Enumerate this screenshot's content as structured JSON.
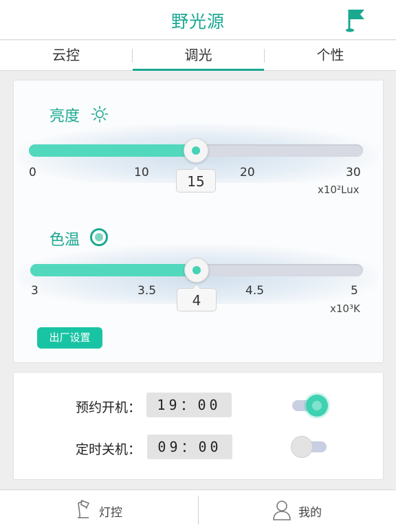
{
  "header": {
    "title": "野光源",
    "flag_icon": "golf-flag-icon"
  },
  "tabs": [
    {
      "label": "云控",
      "active": false
    },
    {
      "label": "调光",
      "active": true
    },
    {
      "label": "个性",
      "active": false
    }
  ],
  "brightness": {
    "title": "亮度",
    "icon": "sun-icon",
    "value": 15,
    "display_value": "15",
    "range": [
      0,
      30
    ],
    "ticks": [
      "0",
      "10",
      "20",
      "30"
    ],
    "unit": "x10²Lux"
  },
  "color_temp": {
    "title": "色温",
    "icon": "temperature-icon",
    "value": 4,
    "display_value": "4",
    "range": [
      3,
      5
    ],
    "ticks": [
      "3",
      "3.5",
      "4.5",
      "5"
    ],
    "unit": "x10³K"
  },
  "factory_reset_label": "出厂设置",
  "schedule": {
    "on": {
      "label": "预约开机：",
      "time": "19：00",
      "enabled": true
    },
    "off": {
      "label": "定时关机：",
      "time": "09：00",
      "enabled": false
    }
  },
  "bottom_nav": [
    {
      "label": "灯控",
      "icon": "lamp-icon"
    },
    {
      "label": "我的",
      "icon": "user-icon"
    }
  ],
  "colors": {
    "accent": "#19a890",
    "slider_fill": "#52d8bd",
    "button": "#19c4a4"
  }
}
